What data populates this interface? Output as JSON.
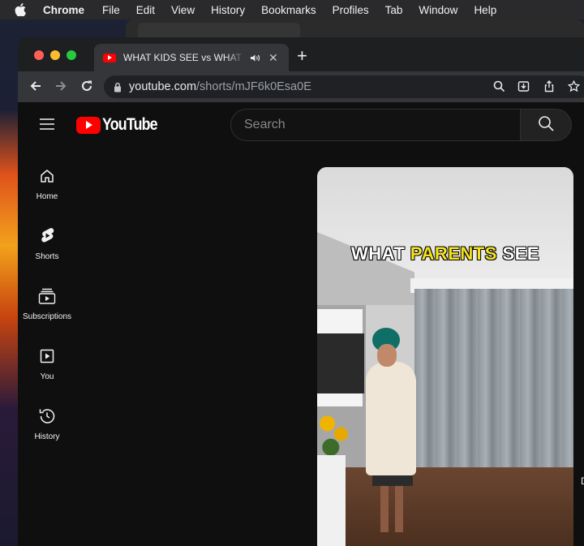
{
  "menubar": {
    "items": [
      "Chrome",
      "File",
      "Edit",
      "View",
      "History",
      "Bookmarks",
      "Profiles",
      "Tab",
      "Window",
      "Help"
    ]
  },
  "browser": {
    "tab_title": "WHAT KIDS SEE vs WHAT PARENTS SEE",
    "new_tab": "+",
    "url_host": "youtube.com",
    "url_path": "/shorts/mJF6k0Esa0E"
  },
  "youtube": {
    "logo_text": "YouTube",
    "search_placeholder": "Search",
    "nav": [
      {
        "label": "Home",
        "icon": "home-icon"
      },
      {
        "label": "Shorts",
        "icon": "shorts-icon"
      },
      {
        "label": "Subscriptions",
        "icon": "subscriptions-icon"
      },
      {
        "label": "You",
        "icon": "you-icon"
      },
      {
        "label": "History",
        "icon": "history-icon"
      }
    ],
    "short": {
      "caption_pre": "WHAT ",
      "caption_highlight": "PARENTS",
      "caption_post": " SEE"
    },
    "side_hint": "D"
  },
  "colors": {
    "youtube_red": "#ff0000",
    "caption_highlight": "#f5e21e",
    "background": "#0f0f0f"
  }
}
